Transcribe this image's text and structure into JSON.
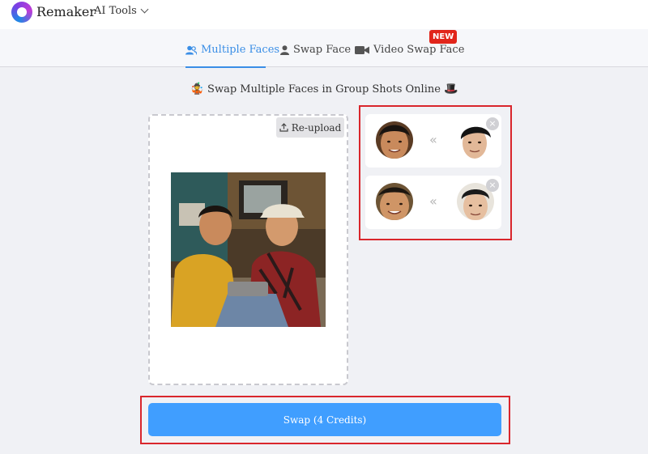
{
  "header": {
    "brand_name": "Remaker",
    "ai_tools_label": "AI Tools"
  },
  "tabs": [
    {
      "label": "Multiple Faces",
      "icon": "users-icon",
      "active": true
    },
    {
      "label": "Swap Face",
      "icon": "user-icon",
      "active": false
    },
    {
      "label": "Video Swap Face",
      "icon": "video-camera-icon",
      "active": false
    }
  ],
  "new_badge": "NEW",
  "headline": {
    "text": "Swap Multiple Faces in Group Shots Online",
    "left_emoji": "🤹",
    "right_emoji": "🎩"
  },
  "upload": {
    "reupload_label": "Re-upload",
    "icon": "upload-icon"
  },
  "face_pairs": [
    {
      "source": "detected-face-1",
      "target": "replacement-face-1",
      "arrow": "«"
    },
    {
      "source": "detected-face-2",
      "target": "replacement-face-2",
      "arrow": "«"
    }
  ],
  "close_glyph": "×",
  "swap_button": {
    "label": "Swap (4 Credits)"
  },
  "colors": {
    "accent": "#409eff",
    "active_tab": "#3a8ee6",
    "highlight_border": "#d9262c",
    "badge": "#e1251b"
  }
}
